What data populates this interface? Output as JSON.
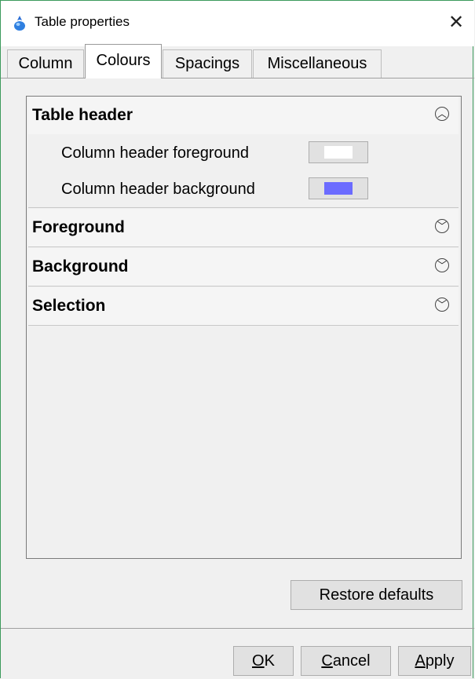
{
  "window": {
    "title": "Table properties",
    "close_glyph": "✕",
    "icon": "app-icon",
    "border_color": "#3c9a5c"
  },
  "tabs": [
    {
      "label": "Column",
      "active": false
    },
    {
      "label": "Colours",
      "active": true
    },
    {
      "label": "Spacings",
      "active": false
    },
    {
      "label": "Miscellaneous",
      "active": false
    }
  ],
  "sections": [
    {
      "label": "Table header",
      "expanded": true,
      "icon": "chevron-up-icon",
      "glyph": "︿",
      "properties": [
        {
          "label": "Column header foreground",
          "color": "#ffffff"
        },
        {
          "label": "Column header background",
          "color": "#6b6bff"
        }
      ]
    },
    {
      "label": "Foreground",
      "expanded": false,
      "icon": "chevron-down-icon",
      "glyph": "﹀"
    },
    {
      "label": "Background",
      "expanded": false,
      "icon": "chevron-down-icon",
      "glyph": "﹀"
    },
    {
      "label": "Selection",
      "expanded": false,
      "icon": "chevron-down-icon",
      "glyph": "﹀"
    }
  ],
  "buttons": {
    "restore_defaults": "Restore defaults",
    "ok_mnemonic": "O",
    "ok_rest": "K",
    "cancel_mnemonic": "C",
    "cancel_rest": "ancel",
    "apply_mnemonic": "A",
    "apply_rest": "pply"
  }
}
